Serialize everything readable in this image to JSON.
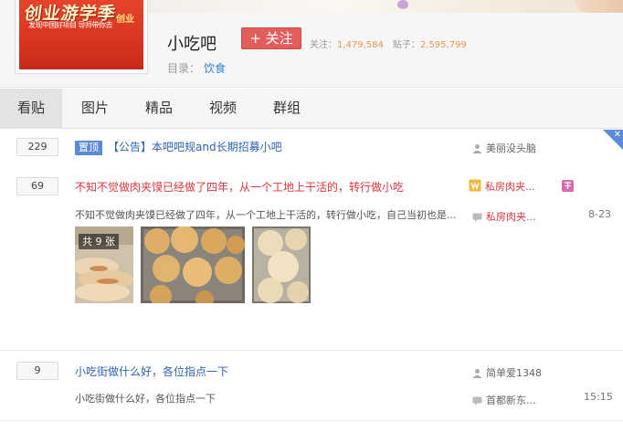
{
  "forum": {
    "avatar_title": "创业游学季",
    "avatar_sub": "发现中国好项目 导师带你去",
    "avatar_tag": "创业",
    "name": "小吃吧",
    "follow_label": "+ 关注",
    "follow_label_text": "关注：",
    "follow_count": "1,479,584",
    "posts_label_text": "贴子：",
    "posts_count": "2,595,799",
    "catalog_label": "目录：",
    "catalog_value": "饮食"
  },
  "tabs": [
    "看贴",
    "图片",
    "精品",
    "视频",
    "群组"
  ],
  "threads": [
    {
      "replies": "229",
      "pin_label": "置顶",
      "title": "【公告】本吧吧规and长期招募小吧",
      "author": "美丽没头脑"
    },
    {
      "replies": "69",
      "title": "不知不觉做肉夹馍已经做了四年，从一个工地上干活的，转行做小吃",
      "abstract": "不知不觉做肉夹馍已经做了四年，从一个工地上干活的，转行做小吃，自己当初也是...",
      "author": "私房肉夹...",
      "last_reply": "私房肉夹...",
      "time": "8-23",
      "image_count_label": "共 9 张"
    },
    {
      "replies": "9",
      "title": "小吃街做什么好，各位指点一下",
      "abstract": "小吃街做什么好，各位指点一下",
      "author": "简单爱1348",
      "last_reply": "首都新东...",
      "time": "15:15"
    }
  ],
  "colors": {
    "link_blue": "#2d64b3",
    "title_red": "#d9373b",
    "follow_red": "#e25e5a",
    "count_orange": "#e8984a",
    "pin_blue": "#5b8bd6"
  }
}
